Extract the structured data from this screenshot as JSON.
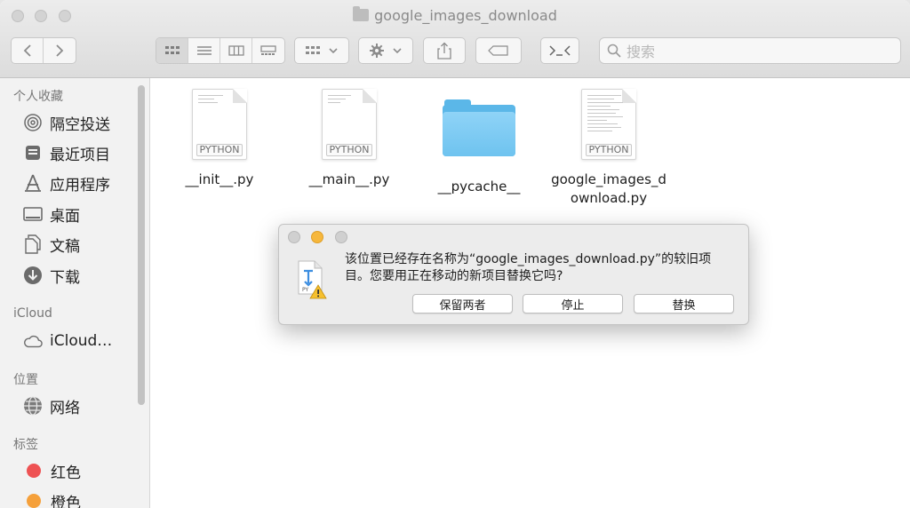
{
  "window": {
    "title": "google_images_download",
    "search_placeholder": "搜索"
  },
  "sidebar": {
    "favorites_heading": "个人收藏",
    "favorites": [
      {
        "label": "隔空投送",
        "icon": "airdrop-icon"
      },
      {
        "label": "最近项目",
        "icon": "recents-icon"
      },
      {
        "label": "应用程序",
        "icon": "applications-icon"
      },
      {
        "label": "桌面",
        "icon": "desktop-icon"
      },
      {
        "label": "文稿",
        "icon": "documents-icon"
      },
      {
        "label": "下载",
        "icon": "downloads-icon"
      }
    ],
    "icloud_heading": "iCloud",
    "icloud_items": [
      {
        "label": "iCloud…",
        "icon": "cloud-icon"
      }
    ],
    "locations_heading": "位置",
    "locations": [
      {
        "label": "网络",
        "icon": "network-icon"
      }
    ],
    "tags_heading": "标签",
    "tags": [
      {
        "label": "红色",
        "color": "#ee5253"
      },
      {
        "label": "橙色",
        "color": "#f5a03a"
      }
    ]
  },
  "files": [
    {
      "name": "__init__.py",
      "kind": "python",
      "badge": "PYTHON"
    },
    {
      "name": "__main__.py",
      "kind": "python",
      "badge": "PYTHON"
    },
    {
      "name": "__pycache__",
      "kind": "folder",
      "badge": ""
    },
    {
      "name_line1": "google_images_d",
      "name_line2": "ownload.py",
      "kind": "python",
      "badge": "PYTHON"
    }
  ],
  "dialog": {
    "message": "该位置已经存在名称为“google_images_download.py”的较旧项目。您要用正在移动的新项目替换它吗?",
    "buttons": {
      "keep_both": "保留两者",
      "stop": "停止",
      "replace": "替换"
    },
    "icon_badge": "PY"
  }
}
